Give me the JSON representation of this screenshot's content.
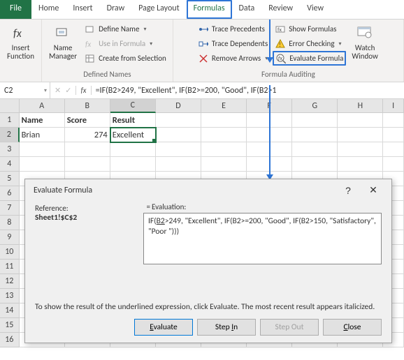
{
  "tabs": {
    "file": "File",
    "home": "Home",
    "insert": "Insert",
    "draw": "Draw",
    "pagelayout": "Page Layout",
    "formulas": "Formulas",
    "data": "Data",
    "review": "Review",
    "view": "View"
  },
  "ribbon": {
    "insert_function": "Insert\nFunction",
    "name_manager": "Name\nManager",
    "define_name": "Define Name",
    "use_in_formula": "Use in Formula",
    "create_from_selection": "Create from Selection",
    "trace_precedents": "Trace Precedents",
    "trace_dependents": "Trace Dependents",
    "remove_arrows": "Remove Arrows",
    "show_formulas": "Show Formulas",
    "error_checking": "Error Checking",
    "evaluate_formula": "Evaluate Formula",
    "watch_window": "Watch\nWindow",
    "group_defined": "Defined Names",
    "group_auditing": "Formula Auditing"
  },
  "namebox": "C2",
  "formula_bar": "=IF(B2>249, \"Excellent\", IF(B2>=200, \"Good\", IF(B2>1",
  "headers": {
    "A": "Name",
    "B": "Score",
    "C": "Result"
  },
  "row2": {
    "A": "Brian",
    "B": "274",
    "C": "Excellent"
  },
  "cols": [
    "A",
    "B",
    "C",
    "D",
    "E",
    "F",
    "G",
    "H",
    "I"
  ],
  "dialog": {
    "title": "Evaluate Formula",
    "ref_label": "Reference:",
    "ref_value": "Sheet1!$C$2",
    "eval_label": "Evaluation:",
    "eval_text_1": "IF(",
    "eval_text_underlined": "B2",
    "eval_text_2": ">249, \"Excellent\", IF(B2>=200, \"Good\", IF(B2>150, \"Satisfactory\", \"Poor \")))",
    "hint": "To show the result of the underlined expression, click Evaluate.  The most recent result appears italicized.",
    "btn_evaluate": "Evaluate",
    "btn_stepin": "Step In",
    "btn_stepout": "Step Out",
    "btn_close": "Close"
  }
}
